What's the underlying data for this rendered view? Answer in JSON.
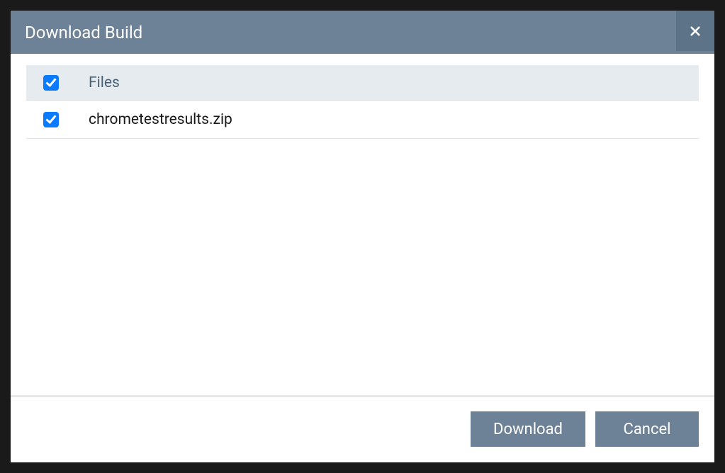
{
  "modal": {
    "title": "Download Build",
    "table": {
      "header_label": "Files",
      "header_checked": true,
      "files": [
        {
          "name": "chrometestresults.zip",
          "checked": true
        }
      ]
    },
    "buttons": {
      "download": "Download",
      "cancel": "Cancel"
    }
  }
}
